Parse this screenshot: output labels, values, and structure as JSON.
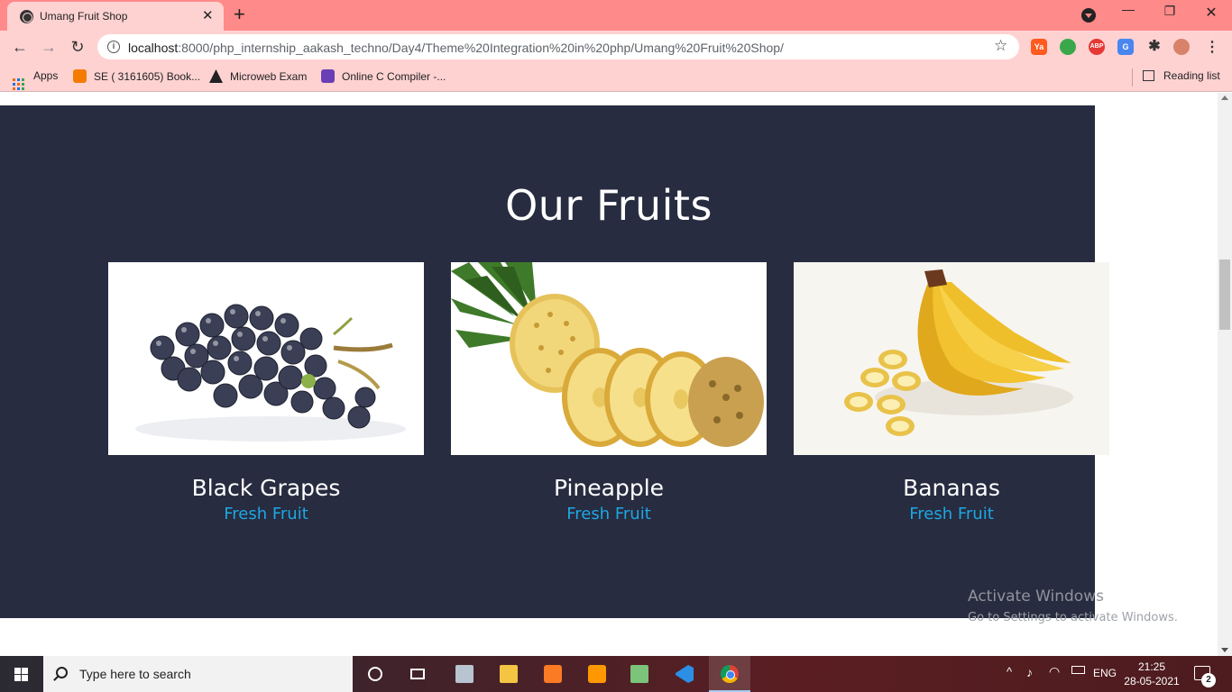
{
  "browser": {
    "tab_title": "Umang Fruit Shop",
    "tab_close": "✕",
    "new_tab": "+",
    "url_host": "localhost",
    "url_rest": ":8000/php_internship_aakash_techno/Day4/Theme%20Integration%20in%20php/Umang%20Fruit%20Shop/",
    "window_controls": {
      "minimize": "—",
      "maximize": "❐",
      "close": "✕"
    },
    "nav": {
      "back": "←",
      "forward": "→",
      "reload": "↻"
    },
    "extensions": [
      "ya-icon",
      "green-globe-icon",
      "abp-icon",
      "translate-icon",
      "puzzle-icon",
      "profile-avatar-icon"
    ],
    "ext_labels": {
      "ya": "Ya",
      "abp": "ABP",
      "translate": "G",
      "puzzle": "✱"
    }
  },
  "bookmarks": {
    "apps": "Apps",
    "items": [
      {
        "label": "SE ( 3161605) Book..."
      },
      {
        "label": "Microweb Exam"
      },
      {
        "label": "Online C Compiler -..."
      }
    ],
    "reading_list": "Reading list"
  },
  "page": {
    "section_title": "Our Fruits",
    "fruits": [
      {
        "name": "Black Grapes",
        "subtitle": "Fresh Fruit"
      },
      {
        "name": "Pineapple",
        "subtitle": "Fresh Fruit"
      },
      {
        "name": "Bananas",
        "subtitle": "Fresh Fruit"
      }
    ],
    "colors": {
      "section_bg": "#272c40",
      "subtitle": "#1ea7e3",
      "title": "#ffffff"
    }
  },
  "watermark": {
    "title": "Activate Windows",
    "subtitle": "Go to Settings to activate Windows."
  },
  "taskbar": {
    "search_placeholder": "Type here to search",
    "apps": [
      "cortana-icon",
      "task-view-icon",
      "explorer-app-icon",
      "file-explorer-icon",
      "xampp-icon",
      "sublime-text-icon",
      "notepad-icon",
      "vscode-icon",
      "chrome-icon"
    ],
    "language": "ENG",
    "time": "21:25",
    "date": "28-05-2021",
    "notification_count": "2"
  }
}
